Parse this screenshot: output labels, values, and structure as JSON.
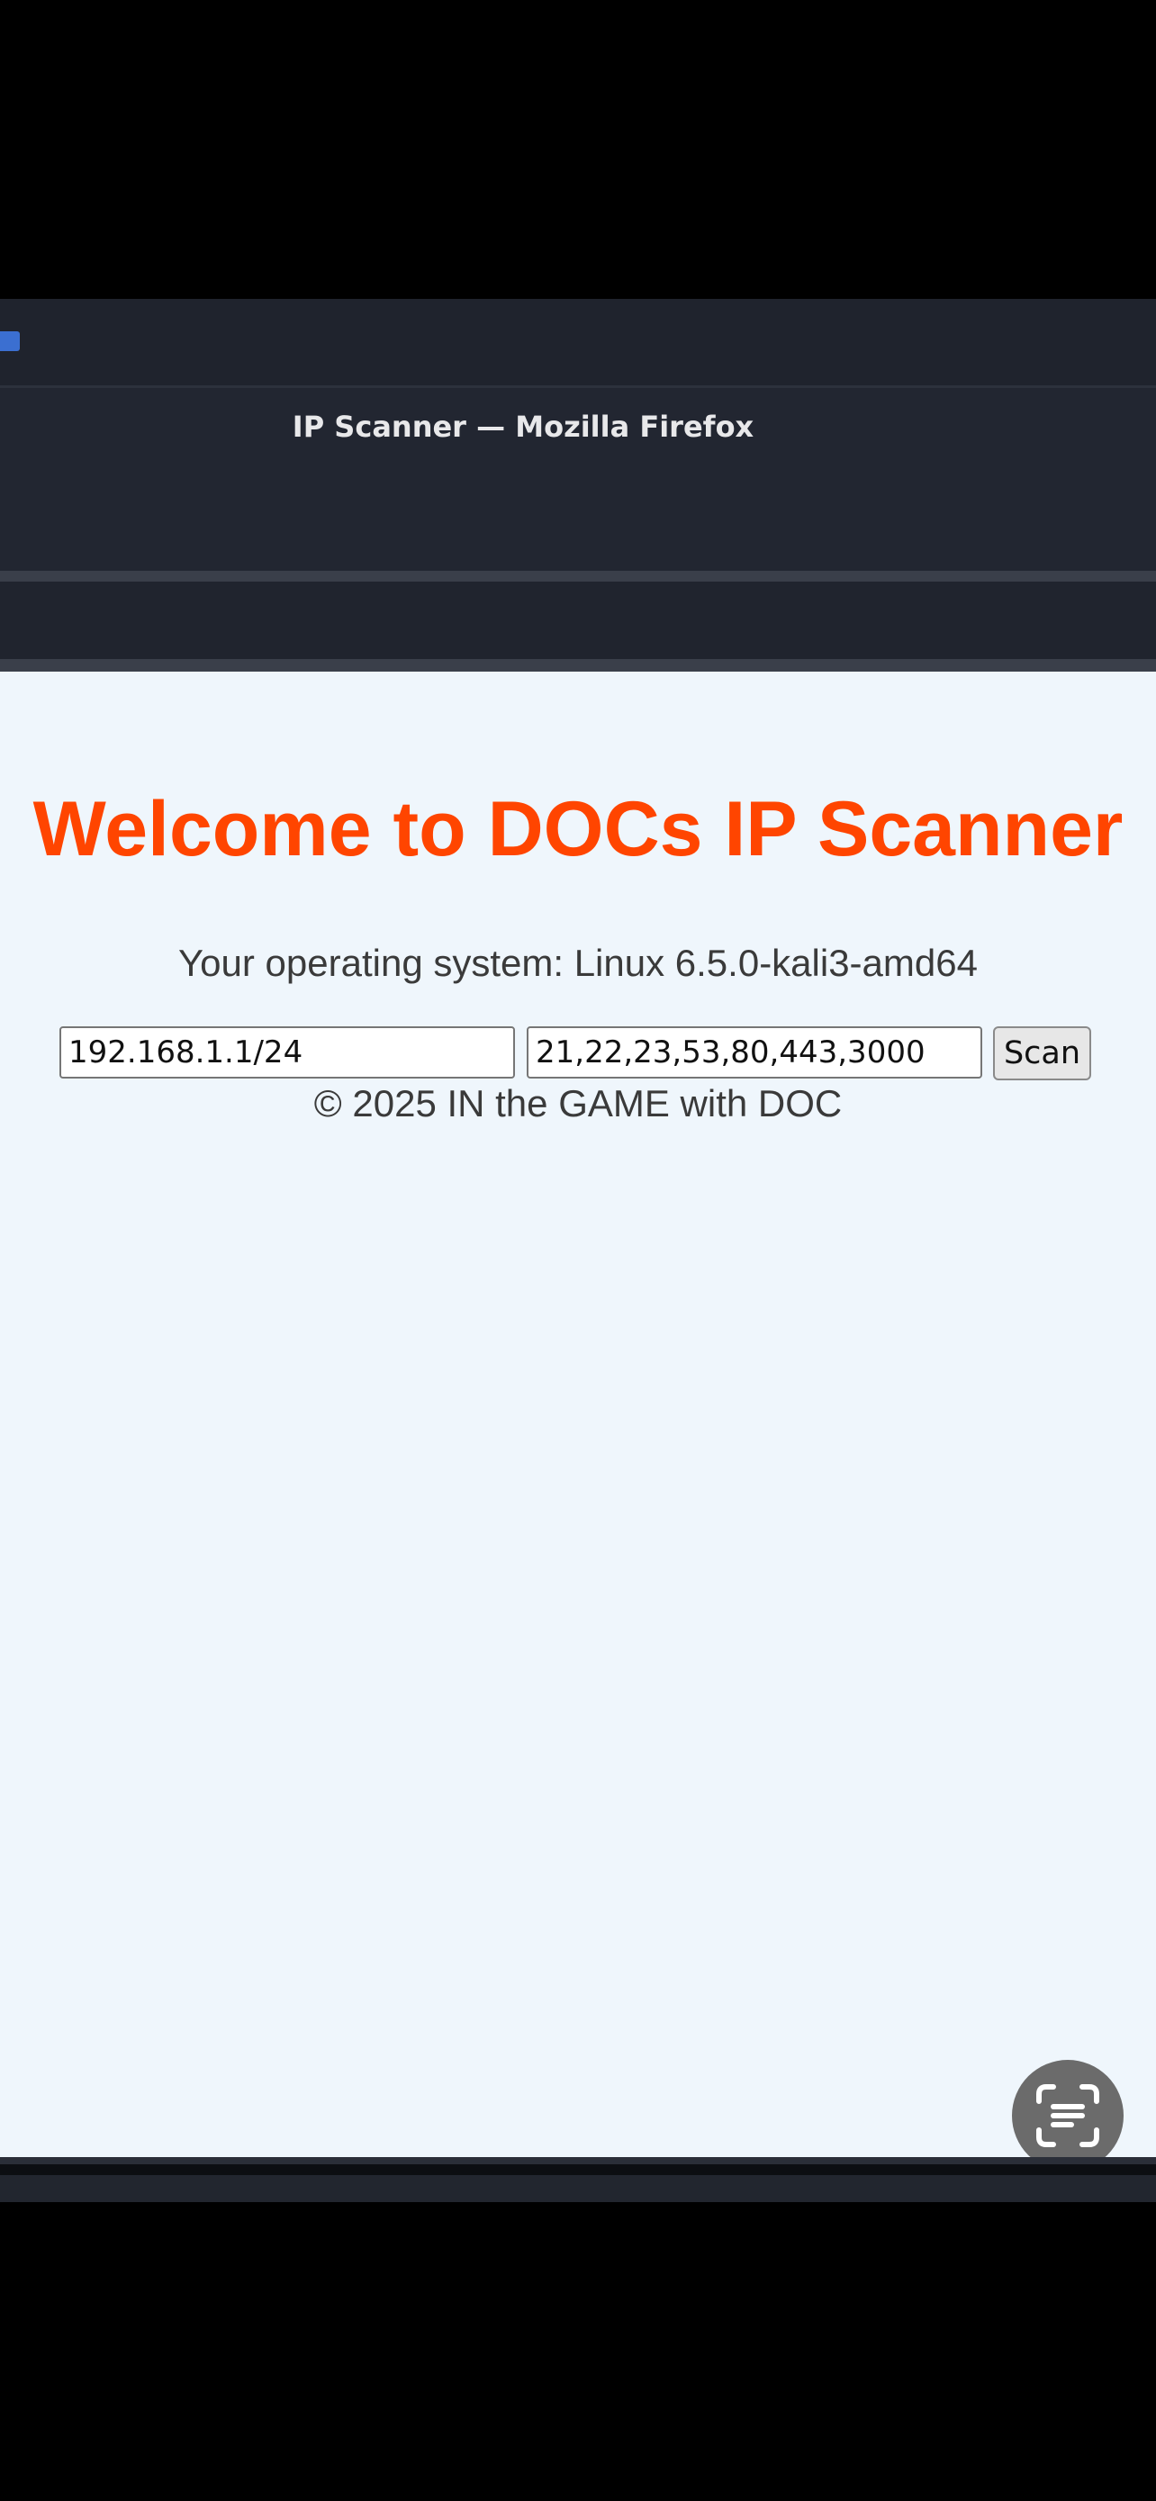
{
  "window": {
    "title": "IP Scanner — Mozilla Firefox"
  },
  "page": {
    "heading": "Welcome to DOCs IP Scanner",
    "os_text": "Your operating system: Linux 6.5.0-kali3-amd64",
    "form": {
      "ip_range_value": "192.168.1.1/24",
      "ports_value": "21,22,23,53,80,443,3000",
      "scan_button_label": "Scan"
    },
    "footer": "© 2025 IN the GAME with DOC"
  },
  "colors": {
    "heading": "#ff4500",
    "page_background": "#eff6fc",
    "titlebar": "#222631"
  },
  "icons": {
    "lens_button": "text-scan-icon"
  }
}
